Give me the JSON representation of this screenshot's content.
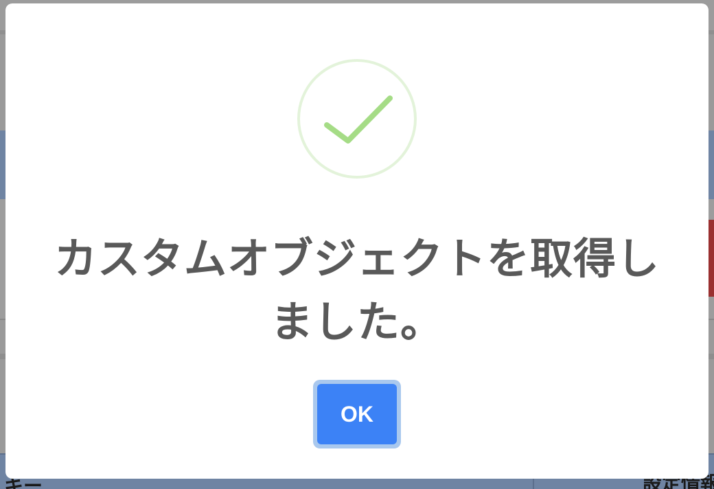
{
  "background": {
    "table": {
      "left_header": "キー",
      "right_header": "設定情報"
    },
    "colors": {
      "overlay": "#9a9a9a",
      "header_band": "#6f84a3",
      "danger_tab": "#9a3030"
    }
  },
  "dialog": {
    "icon": "success-check-icon",
    "message": "カスタムオブジェクトを取得しました。",
    "confirm_label": "OK",
    "colors": {
      "icon_ring": "#e3f3da",
      "icon_check": "#a5dc86",
      "text": "#595959",
      "button": "#3c82f6",
      "button_focus": "#a9c8ee"
    }
  }
}
